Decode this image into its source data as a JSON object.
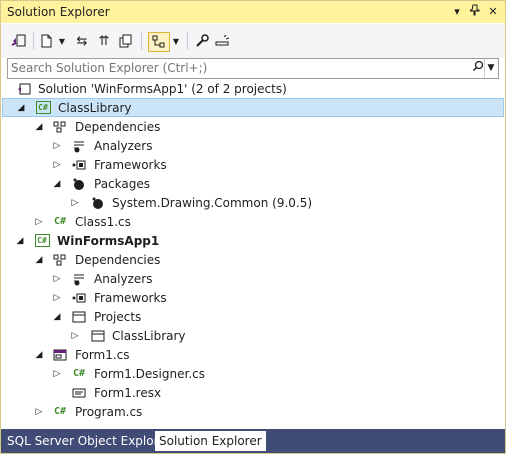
{
  "window": {
    "title": "Solution Explorer",
    "buttons": [
      "▾",
      "⊥",
      "✕"
    ]
  },
  "toolbar": {
    "items": [
      "vs-solution-switch-icon",
      "new-item-icon",
      "dropdown-arrow",
      "sync-icon",
      "collapse-all-icon",
      "show-all-files-icon",
      "track-active-icon",
      "dropdown-arrow",
      "properties-wrench-icon",
      "preview-icon"
    ]
  },
  "search": {
    "placeholder": "Search Solution Explorer (Ctrl+;)"
  },
  "tree": {
    "solution": "Solution 'WinFormsApp1' (2 of 2 projects)",
    "nodes": [
      {
        "label": "ClassLibrary",
        "bold": false
      },
      {
        "label": "Dependencies"
      },
      {
        "label": "Analyzers"
      },
      {
        "label": "Frameworks"
      },
      {
        "label": "Packages"
      },
      {
        "label": "System.Drawing.Common (9.0.5)"
      },
      {
        "label": "Class1.cs"
      },
      {
        "label": "WinFormsApp1",
        "bold": true
      },
      {
        "label": "Dependencies"
      },
      {
        "label": "Analyzers"
      },
      {
        "label": "Frameworks"
      },
      {
        "label": "Projects"
      },
      {
        "label": "ClassLibrary"
      },
      {
        "label": "Form1.cs"
      },
      {
        "label": "Form1.Designer.cs"
      },
      {
        "label": "Form1.resx"
      },
      {
        "label": "Program.cs"
      }
    ]
  },
  "tabs": {
    "sql": "SQL Server Object Explorer",
    "solution": "Solution Explorer"
  }
}
